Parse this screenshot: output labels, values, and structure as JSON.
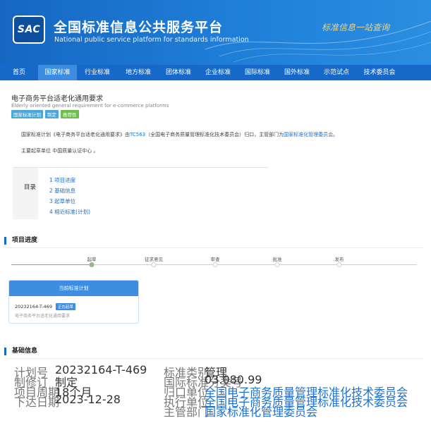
{
  "header": {
    "logo_text": "SAC",
    "title": "全国标准信息公共服务平台",
    "subtitle": "National public service platform  for standards information",
    "slogan": "标准信息一站查询"
  },
  "nav": {
    "items": [
      {
        "label": "首页",
        "active": false
      },
      {
        "label": "国家标准",
        "active": true
      },
      {
        "label": "行业标准",
        "active": false
      },
      {
        "label": "地方标准",
        "active": false
      },
      {
        "label": "团体标准",
        "active": false
      },
      {
        "label": "企业标准",
        "active": false
      },
      {
        "label": "国际标准",
        "active": false
      },
      {
        "label": "国外标准",
        "active": false
      },
      {
        "label": "示范试点",
        "active": false
      },
      {
        "label": "技术委员会",
        "active": false
      }
    ]
  },
  "standard": {
    "title": "电子商务平台适老化通用要求",
    "english_title": "Elderly oriented general requirement for e-commerce platforms",
    "tags": [
      {
        "label": "国家标准计划",
        "color": "#4aa7d6"
      },
      {
        "label": "制定",
        "color": "#4aa7d6"
      },
      {
        "label": "推荐性",
        "color": "#6cbf4d"
      }
    ],
    "desc_prefix": "国家标准计划《电子商务平台适老化通用要求》由",
    "desc_tc": "TC563",
    "desc_middle": "（全国电子商务质量管理标准化技术委员会）归口，主管部门为",
    "desc_dept": "国家标准化管理委员会",
    "desc_suffix": "。",
    "org_text": "主要起草单位 中国质量认证中心 。"
  },
  "toc": {
    "label": "目录",
    "items": [
      "1  项目进度",
      "2  基础信息",
      "3  起草单位",
      "4  相近标准(计划)"
    ]
  },
  "progress": {
    "heading": "项目进度",
    "steps": [
      {
        "label": "起草",
        "done": true
      },
      {
        "label": "征求意见",
        "done": false
      },
      {
        "label": "审查",
        "done": false
      },
      {
        "label": "批准",
        "done": false
      },
      {
        "label": "发布",
        "done": false
      }
    ],
    "card_title": "当前标准计划",
    "card_code": "20232164-T-469",
    "card_badge": "正在起草",
    "card_name": "电子商务平台适老化通用要求"
  },
  "basic": {
    "heading": "基础信息",
    "left": [
      {
        "k": "计划号",
        "v": "20232164-T-469"
      },
      {
        "k": "制修订",
        "v": "制定"
      },
      {
        "k": "项目周期",
        "v": "18个月"
      },
      {
        "k": "下达日期",
        "v": "2023-12-28"
      }
    ],
    "right": [
      {
        "k": "标准类别",
        "v": "管理",
        "link": false
      },
      {
        "k": "国际标准分类号",
        "v": "03.080.99",
        "link": false
      },
      {
        "k": "归口单位",
        "v": "全国电子商务质量管理标准化技术委员会",
        "link": true
      },
      {
        "k": "执行单位",
        "v": "全国电子商务质量管理标准化技术委员会",
        "link": true
      },
      {
        "k": "主管部门",
        "v": "国家标准化管理委员会",
        "link": true
      }
    ]
  }
}
